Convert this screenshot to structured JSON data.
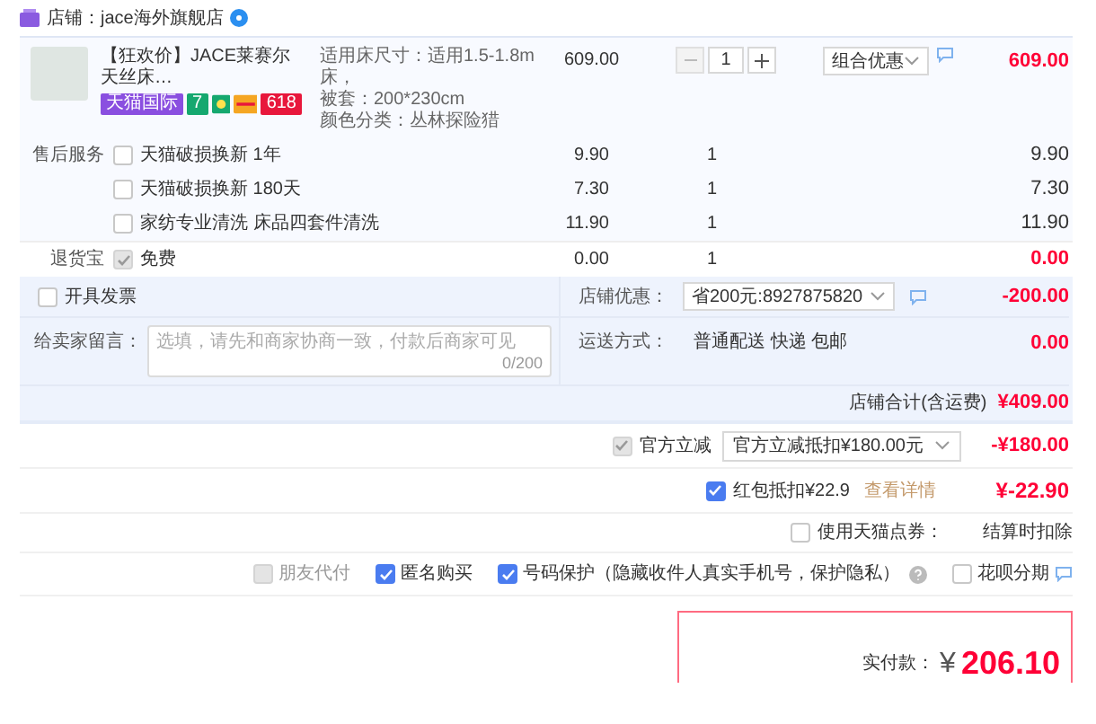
{
  "shop": {
    "name": "店铺：jace海外旗舰店"
  },
  "product": {
    "title": "【狂欢价】JACE莱赛尔天丝床…",
    "badges": [
      {
        "kind": "label",
        "text": "天猫国际",
        "color": "#8a4fe0"
      },
      {
        "kind": "label",
        "text": "7",
        "color": "#15a86f"
      },
      {
        "kind": "flower",
        "color": "#15a86f"
      },
      {
        "kind": "card",
        "color": "#f5a623"
      },
      {
        "kind": "label",
        "text": "618",
        "color": "#e8173c"
      }
    ],
    "attributes": [
      "适用床尺寸：适用1.5-1.8m床，",
      "被套：200*230cm",
      "颜色分类：丛林探险猎"
    ],
    "price": "609.00",
    "quantity": "1",
    "promo": "组合优惠",
    "subtotal": "609.00"
  },
  "services": {
    "label": "售后服务",
    "items": [
      {
        "text": "天猫破损换新 1年",
        "checked": false,
        "price": "9.90",
        "quantity": "1",
        "subtotal": "9.90"
      },
      {
        "text": "天猫破损换新 180天",
        "checked": false,
        "price": "7.30",
        "quantity": "1",
        "subtotal": "7.30"
      },
      {
        "text": "家纺专业清洗 床品四套件清洗",
        "checked": false,
        "price": "11.90",
        "quantity": "1",
        "subtotal": "11.90"
      }
    ]
  },
  "return_insurance": {
    "label": "退货宝",
    "checked": true,
    "disabled": true,
    "text": "免费",
    "price": "0.00",
    "quantity": "1",
    "subtotal": "0.00"
  },
  "invoice": {
    "label": "开具发票",
    "checked": false
  },
  "shop_discount": {
    "label": "店铺优惠：",
    "value": "省200元:8927875820",
    "amount": "-200.00"
  },
  "message": {
    "label": "给卖家留言：",
    "placeholder": "选填，请先和商家协商一致，付款后商家可见",
    "counter": "0/200"
  },
  "shipping": {
    "label": "运送方式：",
    "value": "普通配送 快递 包邮",
    "amount": "0.00"
  },
  "shop_total": {
    "label": "店铺合计(含运费)",
    "amount": "¥409.00"
  },
  "official_discount": {
    "checked": true,
    "disabled": true,
    "label": "官方立减",
    "value": "官方立减抵扣¥180.00元",
    "amount": "-¥180.00"
  },
  "red_packet": {
    "checked": true,
    "label": "红包抵扣¥22.9",
    "link": "查看详情",
    "amount": "¥-22.90"
  },
  "points": {
    "checked": false,
    "label": "使用天猫点券：",
    "note": "结算时扣除"
  },
  "options": [
    {
      "label": "朋友代付",
      "checked": false,
      "disabled": true,
      "help": false,
      "chat": false
    },
    {
      "label": "匿名购买",
      "checked": true,
      "disabled": false,
      "help": false,
      "chat": false
    },
    {
      "label": "号码保护（隐藏收件人真实手机号，保护隐私）",
      "checked": true,
      "disabled": false,
      "help": true,
      "chat": false
    },
    {
      "label": "花呗分期",
      "checked": false,
      "disabled": false,
      "help": false,
      "chat": true
    }
  ],
  "payment": {
    "label": "实付款：",
    "currency": "¥",
    "amount": "206.10"
  }
}
